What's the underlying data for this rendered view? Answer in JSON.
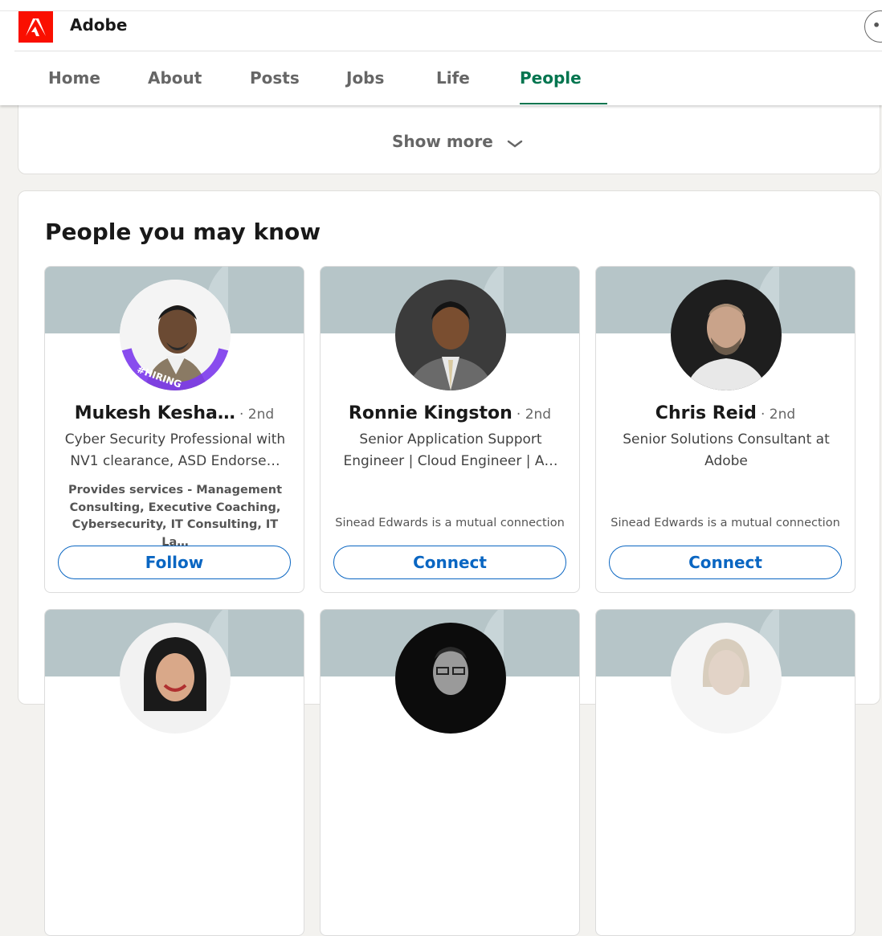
{
  "company": {
    "name": "Adobe",
    "logo_icon": "adobe-logo",
    "brand_color": "#fa0f00"
  },
  "tabs": [
    {
      "label": "Home"
    },
    {
      "label": "About"
    },
    {
      "label": "Posts"
    },
    {
      "label": "Jobs"
    },
    {
      "label": "Life"
    },
    {
      "label": "People"
    }
  ],
  "active_tab": "People",
  "accent_color": "#01754f",
  "show_more": {
    "label": "Show more",
    "icon": "chevron-down-icon"
  },
  "section": {
    "title": "People you may know"
  },
  "people": [
    {
      "name": "Mukesh Kesha…",
      "degree": "· 2nd",
      "headline": "Cyber Security Professional with NV1 clearance, ASD Endorse…",
      "services": "Provides services - Management Consulting, Executive Coaching, Cybersecurity, IT Consulting, IT La…",
      "mutual": "",
      "action": "Follow",
      "badge": "#HIRING"
    },
    {
      "name": "Ronnie Kingston",
      "degree": "· 2nd",
      "headline": "Senior Application Support Engineer | Cloud Engineer | A…",
      "services": "",
      "mutual": "Sinead Edwards is a mutual connection",
      "action": "Connect",
      "badge": ""
    },
    {
      "name": "Chris Reid",
      "degree": "· 2nd",
      "headline": "Senior Solutions Consultant at Adobe",
      "services": "",
      "mutual": "Sinead Edwards is a mutual connection",
      "action": "Connect",
      "badge": ""
    },
    {
      "name": "",
      "degree": "",
      "headline": "",
      "services": "",
      "mutual": "",
      "action": "",
      "badge": ""
    },
    {
      "name": "",
      "degree": "",
      "headline": "",
      "services": "",
      "mutual": "",
      "action": "",
      "badge": ""
    },
    {
      "name": "",
      "degree": "",
      "headline": "",
      "services": "",
      "mutual": "",
      "action": "",
      "badge": ""
    }
  ],
  "button_color": "#0a66c2"
}
